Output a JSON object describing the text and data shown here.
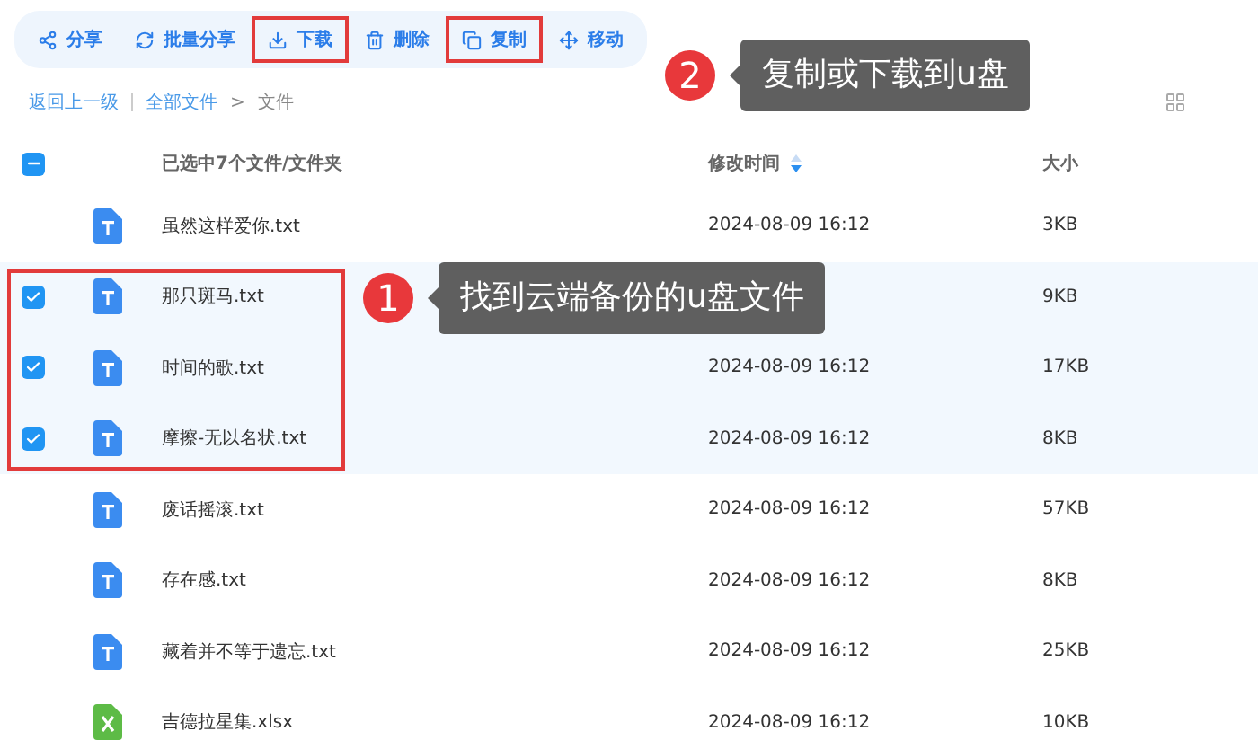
{
  "toolbar": [
    {
      "kind": "share",
      "label": "分享",
      "highlighted": false
    },
    {
      "kind": "batch-share",
      "label": "批量分享",
      "highlighted": false
    },
    {
      "kind": "download",
      "label": "下载",
      "highlighted": true
    },
    {
      "kind": "delete",
      "label": "删除",
      "highlighted": false
    },
    {
      "kind": "copy",
      "label": "复制",
      "highlighted": true
    },
    {
      "kind": "move",
      "label": "移动",
      "highlighted": false
    }
  ],
  "breadcrumb": {
    "back": "返回上一级",
    "items": [
      "全部文件",
      "文件"
    ],
    "separator": ">"
  },
  "table": {
    "select_all": {
      "label": "已选中7个文件/文件夹",
      "indeterminate": true
    },
    "columns": [
      "修改时间",
      "大小"
    ],
    "rows": [
      {
        "kind": "text",
        "name": "虽然这样爱你.txt",
        "time": "2024-08-09 16:12",
        "size": "3KB",
        "selected": false,
        "highlighted": false
      },
      {
        "kind": "text",
        "name": "那只斑马.txt",
        "size": "9KB",
        "selected": true,
        "highlighted": true
      },
      {
        "kind": "text",
        "name": "时间的歌.txt",
        "time": "2024-08-09 16:12",
        "size": "17KB",
        "selected": true,
        "highlighted": true
      },
      {
        "kind": "text",
        "name": "摩擦-无以名状.txt",
        "time": "2024-08-09 16:12",
        "size": "8KB",
        "selected": true,
        "highlighted": true
      },
      {
        "kind": "text",
        "name": "废话摇滚.txt",
        "time": "2024-08-09 16:12",
        "size": "57KB",
        "selected": false,
        "highlighted": false
      },
      {
        "kind": "text",
        "name": "存在感.txt",
        "time": "2024-08-09 16:12",
        "size": "8KB",
        "selected": false,
        "highlighted": false
      },
      {
        "kind": "text",
        "name": "藏着并不等于遗忘.txt",
        "time": "2024-08-09 16:12",
        "size": "25KB",
        "selected": false,
        "highlighted": false
      },
      {
        "kind": "spreadsheet",
        "name": "吉德拉星集.xlsx",
        "time": "2024-08-09 16:12",
        "size": "10KB",
        "selected": false,
        "highlighted": false
      }
    ]
  },
  "callouts": [
    {
      "number": "1",
      "text": "找到云端备份的u盘文件"
    },
    {
      "number": "2",
      "text": "复制或下载到u盘"
    }
  ]
}
